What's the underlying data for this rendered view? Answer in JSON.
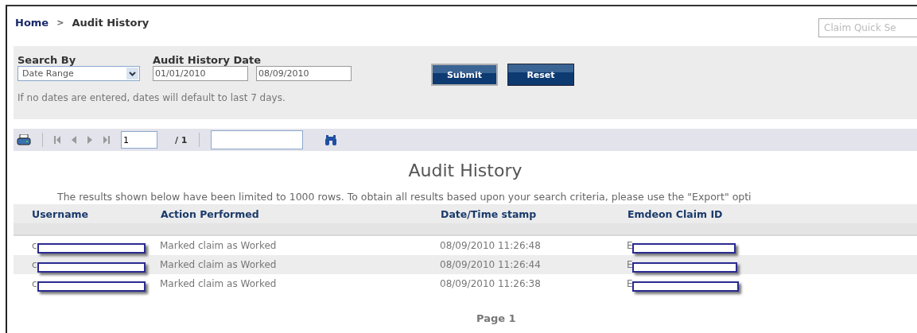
{
  "breadcrumb": [
    {
      "label": "Home",
      "kind": "link"
    },
    {
      "label": ">",
      "kind": "separator"
    },
    {
      "label": "Audit History",
      "kind": "current"
    }
  ],
  "quick_search": {
    "placeholder": "Claim Quick Se"
  },
  "search_form": {
    "search_by": {
      "label": "Search By",
      "value": "Date Range"
    },
    "date": {
      "label": "Audit History Date",
      "from": "01/01/2010",
      "to": "08/09/2010"
    },
    "buttons": [
      {
        "label": "Submit",
        "focused": true
      },
      {
        "label": "Reset",
        "focused": false
      }
    ],
    "hint": "If no dates are entered, dates will default to last 7 days."
  },
  "toolbar": {
    "page": "1",
    "page_total": "/ 1"
  },
  "report": {
    "title": "Audit History",
    "notice": "The results shown below have been limited to 1000 rows. To obtain all results based upon your search criteria, please use the \"Export\" opti",
    "table": {
      "columns": [
        "Username",
        "Action Performed",
        "Date/Time stamp",
        "Emdeon Claim ID"
      ],
      "rows": [
        {
          "username": "c",
          "action": "Marked claim as Worked",
          "timestamp": "08/09/2010 11:26:48",
          "claim_id": "E"
        },
        {
          "username": "c",
          "action": "Marked claim as Worked",
          "timestamp": "08/09/2010 11:26:44",
          "claim_id": "E"
        },
        {
          "username": "c",
          "action": "Marked claim as Worked",
          "timestamp": "08/09/2010 11:26:38",
          "claim_id": "E"
        }
      ]
    },
    "footer": "Page 1"
  }
}
